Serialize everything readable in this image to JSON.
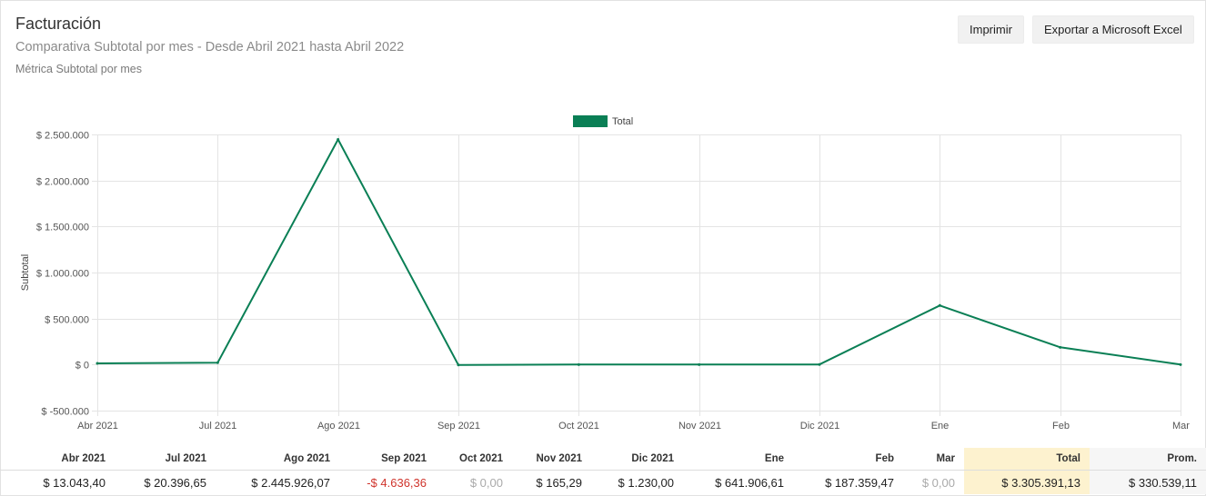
{
  "header": {
    "title": "Facturación",
    "subtitle": "Comparativa Subtotal por mes - Desde Abril 2021 hasta Abril 2022",
    "metric": "Métrica Subtotal por mes"
  },
  "buttons": {
    "print": "Imprimir",
    "export_excel": "Exportar a Microsoft Excel"
  },
  "colors": {
    "series": "#0a7f55",
    "grid": "#e4e4e4",
    "negative": "#d0342c",
    "total_bg": "#fdf2cf"
  },
  "chart_data": {
    "type": "line",
    "ylabel": "Subtotal",
    "xlabel": "",
    "categories": [
      "Abr 2021",
      "Jul 2021",
      "Ago 2021",
      "Sep 2021",
      "Oct 2021",
      "Nov 2021",
      "Dic 2021",
      "Ene",
      "Feb",
      "Mar"
    ],
    "series": [
      {
        "name": "Total",
        "values": [
          13043.4,
          20396.65,
          2445926.07,
          -4636.36,
          0.0,
          165.29,
          1230.0,
          641906.61,
          187359.47,
          0.0
        ]
      }
    ],
    "ylim": [
      -500000,
      2500000
    ],
    "yticks": [
      2500000,
      2000000,
      1500000,
      1000000,
      500000,
      0,
      -500000
    ],
    "ytick_labels": [
      "$ 2.500.000",
      "$ 2.000.000",
      "$ 1.500.000",
      "$ 1.000.000",
      "$ 500.000",
      "$ 0",
      "$ -500.000"
    ],
    "grid": true,
    "legend_position": "top-center"
  },
  "table": {
    "headers": [
      "Abr 2021",
      "Jul 2021",
      "Ago 2021",
      "Sep 2021",
      "Oct 2021",
      "Nov 2021",
      "Dic 2021",
      "Ene",
      "Feb",
      "Mar",
      "Total",
      "Prom."
    ],
    "values": [
      "$ 13.043,40",
      "$ 20.396,65",
      "$ 2.445.926,07",
      "-$ 4.636,36",
      "$ 0,00",
      "$ 165,29",
      "$ 1.230,00",
      "$ 641.906,61",
      "$ 187.359,47",
      "$ 0,00",
      "$ 3.305.391,13",
      "$ 330.539,11"
    ],
    "styles": [
      "",
      "",
      "",
      "neg",
      "zero",
      "",
      "",
      "",
      "",
      "zero",
      "",
      ""
    ]
  }
}
